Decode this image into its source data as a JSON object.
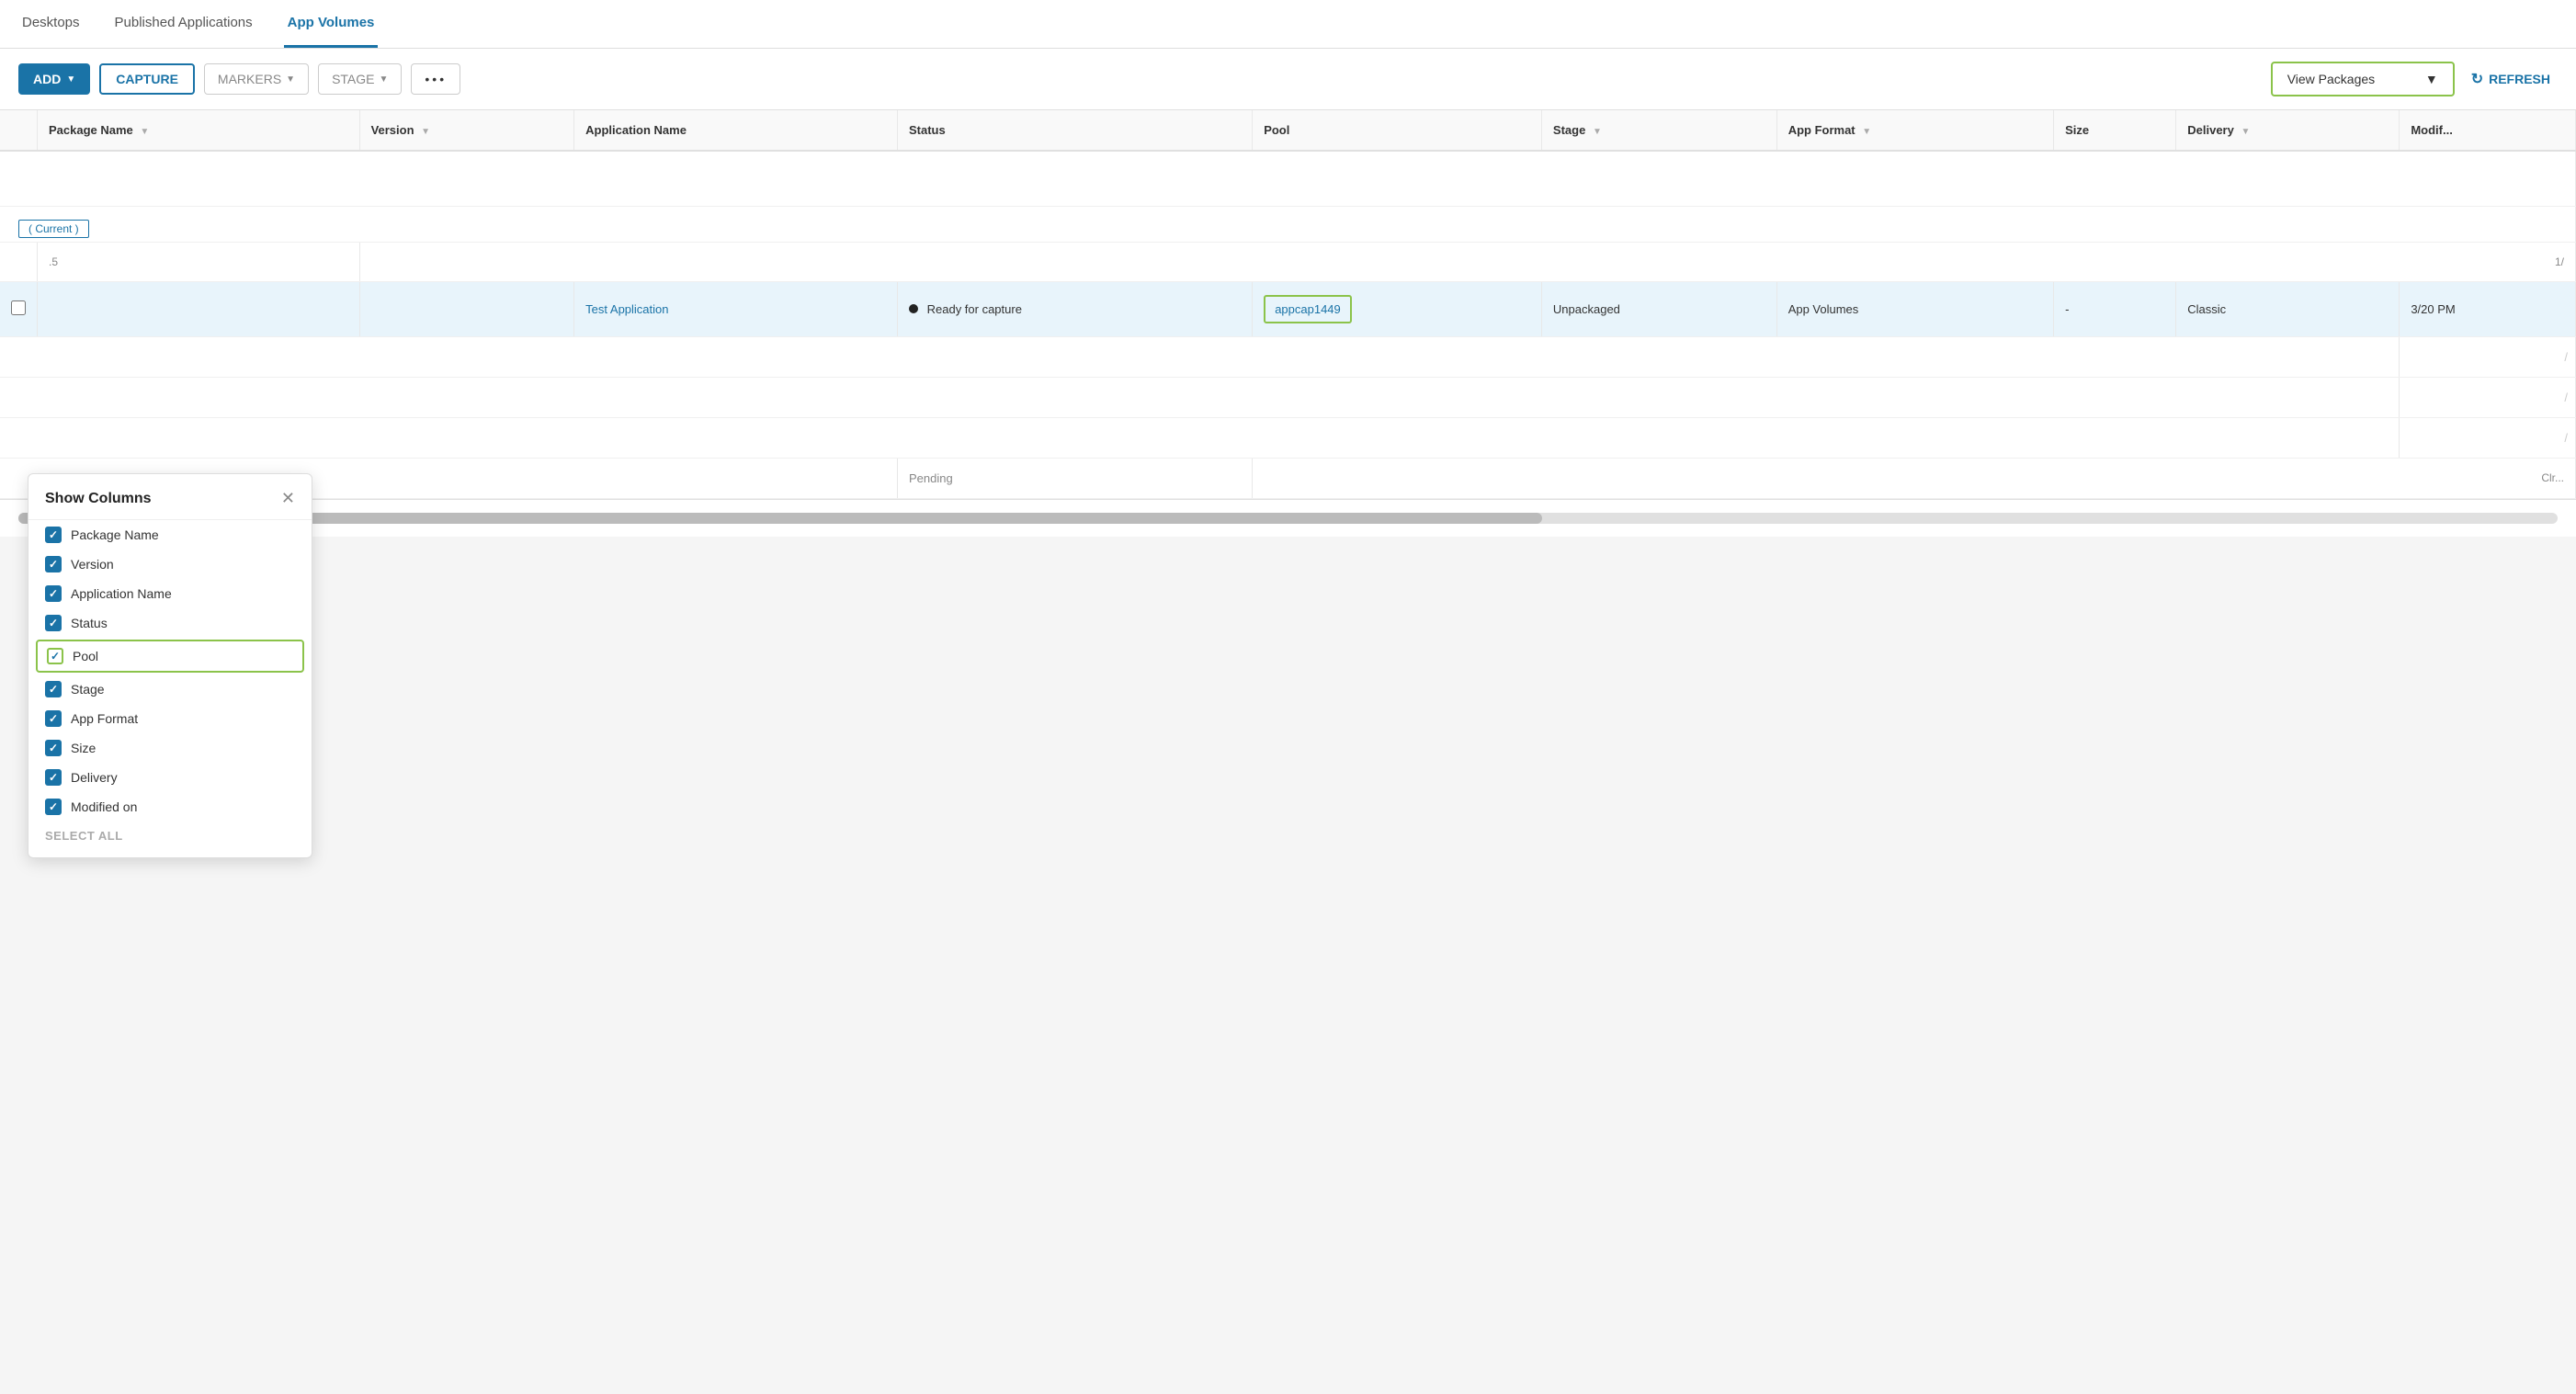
{
  "tabs": [
    {
      "id": "desktops",
      "label": "Desktops",
      "active": false
    },
    {
      "id": "published-applications",
      "label": "Published Applications",
      "active": false
    },
    {
      "id": "app-volumes",
      "label": "App Volumes",
      "active": true
    }
  ],
  "toolbar": {
    "add_label": "ADD",
    "capture_label": "CAPTURE",
    "markers_label": "MARKERS",
    "stage_label": "STAGE",
    "dots_label": "•••",
    "view_packages_label": "View Packages",
    "refresh_label": "REFRESH"
  },
  "table": {
    "columns": [
      {
        "id": "package-name",
        "label": "Package Name",
        "filterable": true
      },
      {
        "id": "version",
        "label": "Version",
        "filterable": true
      },
      {
        "id": "application-name",
        "label": "Application Name",
        "filterable": false
      },
      {
        "id": "status",
        "label": "Status",
        "filterable": false
      },
      {
        "id": "pool",
        "label": "Pool",
        "filterable": false
      },
      {
        "id": "stage",
        "label": "Stage",
        "filterable": true
      },
      {
        "id": "app-format",
        "label": "App Format",
        "filterable": true
      },
      {
        "id": "size",
        "label": "Size",
        "filterable": false
      },
      {
        "id": "delivery",
        "label": "Delivery",
        "filterable": true
      },
      {
        "id": "modified",
        "label": "Modif...",
        "filterable": false
      }
    ],
    "rows": [
      {
        "package_name": "",
        "version": "",
        "application_name": "Test Application",
        "status": "Ready for capture",
        "pool": "appcap1449",
        "stage": "Unpackaged",
        "app_format": "App Volumes",
        "size": "-",
        "delivery": "Classic",
        "modified": "3/20 PM",
        "highlighted": true
      }
    ],
    "current_label": "( Current )",
    "version_value": ".5",
    "page_info": "1/"
  },
  "show_columns_popup": {
    "title": "Show Columns",
    "items": [
      {
        "id": "package-name",
        "label": "Package Name",
        "checked": true,
        "outlined": false
      },
      {
        "id": "version",
        "label": "Version",
        "checked": true,
        "outlined": false
      },
      {
        "id": "application-name",
        "label": "Application Name",
        "checked": true,
        "outlined": false
      },
      {
        "id": "status",
        "label": "Status",
        "checked": true,
        "outlined": false
      },
      {
        "id": "pool",
        "label": "Pool",
        "checked": true,
        "outlined": true
      },
      {
        "id": "stage",
        "label": "Stage",
        "checked": true,
        "outlined": false
      },
      {
        "id": "app-format",
        "label": "App Format",
        "checked": true,
        "outlined": false
      },
      {
        "id": "size",
        "label": "Size",
        "checked": true,
        "outlined": false
      },
      {
        "id": "delivery",
        "label": "Delivery",
        "checked": true,
        "outlined": false
      },
      {
        "id": "modified-on",
        "label": "Modified on",
        "checked": true,
        "outlined": false
      }
    ],
    "select_all_label": "SELECT ALL"
  },
  "pending_label": "Pending"
}
